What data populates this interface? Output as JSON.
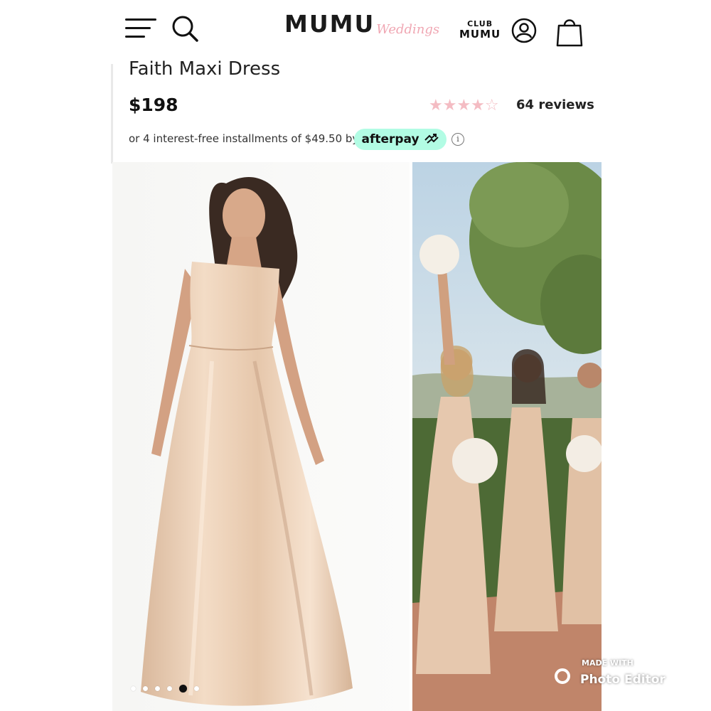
{
  "header": {
    "logo_main": "MUMU",
    "logo_script": "Weddings",
    "club_line1": "CLUB",
    "club_line2": "MUMU"
  },
  "product": {
    "title": "Faith Maxi Dress",
    "price": "$198",
    "rating": 4.5,
    "rating_max": 5,
    "stars": "★★★★☆",
    "reviews_label": "64 reviews",
    "installment_text": "or 4 interest-free installments of $49.50 by",
    "afterpay_label": "afterpay",
    "info_glyph": "i"
  },
  "gallery": {
    "dot_count": 6,
    "active_index": 4
  },
  "watermark": {
    "line1": "MADE WITH",
    "line2": "Photo Editor"
  },
  "colors": {
    "star": "#f4bcc3",
    "afterpay_bg": "#b2fce4",
    "logo_script": "#f0a7b3",
    "dress": "#e9cdb6"
  },
  "icons": [
    "hamburger-menu-icon",
    "search-icon",
    "account-icon",
    "shopping-bag-icon",
    "info-icon",
    "afterpay-arrows-icon"
  ]
}
